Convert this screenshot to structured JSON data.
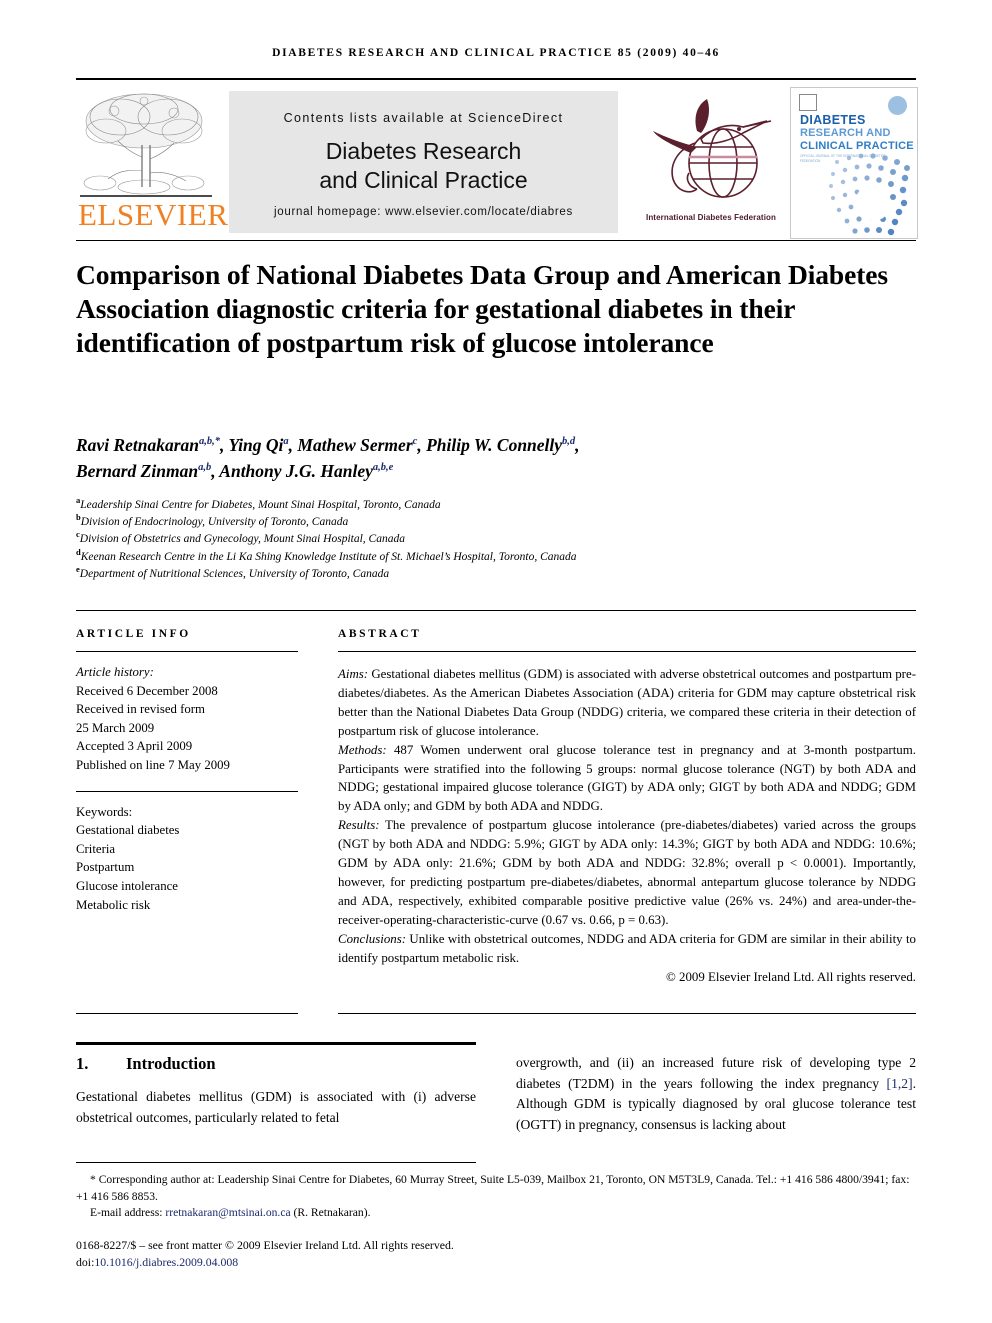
{
  "running_head": "Diabetes Research and Clinical Practice 85 (2009) 40–46",
  "masthead": {
    "publisher_name": "ELSEVIER",
    "publisher_color": "#F08122",
    "contents_line": "Contents lists available at ScienceDirect",
    "journal_title_line1": "Diabetes Research",
    "journal_title_line2": "and Clinical Practice",
    "homepage_line": "journal homepage: www.elsevier.com/locate/diabres",
    "idf_caption": "International Diabetes Federation",
    "cover": {
      "line1": "DIABETES",
      "line2": "RESEARCH AND",
      "line3": "CLINICAL PRACTICE",
      "subline": "OFFICIAL JOURNAL OF THE INTERNATIONAL DIABETES FEDERATION",
      "accent_color": "#2f7ec4"
    }
  },
  "article": {
    "title": "Comparison of National Diabetes Data Group and American Diabetes Association diagnostic criteria for gestational diabetes in their identification of postpartum risk of glucose intolerance",
    "authors_line1_a": "Ravi Retnakaran",
    "authors_line1_a_sup": "a,b,*",
    "authors_line1_b": ", Ying Qi",
    "authors_line1_b_sup": "a",
    "authors_line1_c": ", Mathew Sermer",
    "authors_line1_c_sup": "c",
    "authors_line1_d": ", Philip W. Connelly",
    "authors_line1_d_sup": "b,d",
    "authors_line1_end": ",",
    "authors_line2_a": "Bernard Zinman",
    "authors_line2_a_sup": "a,b",
    "authors_line2_b": ", Anthony J.G. Hanley",
    "authors_line2_b_sup": "a,b,e",
    "affiliations": [
      {
        "marker": "a",
        "text": "Leadership Sinai Centre for Diabetes, Mount Sinai Hospital, Toronto, Canada"
      },
      {
        "marker": "b",
        "text": "Division of Endocrinology, University of Toronto, Canada"
      },
      {
        "marker": "c",
        "text": "Division of Obstetrics and Gynecology, Mount Sinai Hospital, Canada"
      },
      {
        "marker": "d",
        "text": "Keenan Research Centre in the Li Ka Shing Knowledge Institute of St. Michael’s Hospital, Toronto, Canada"
      },
      {
        "marker": "e",
        "text": "Department of Nutritional Sciences, University of Toronto, Canada"
      }
    ]
  },
  "article_info": {
    "heading": "ARTICLE INFO",
    "history_label": "Article history:",
    "history": [
      "Received 6 December 2008",
      "Received in revised form",
      "25 March 2009",
      "Accepted 3 April 2009",
      "Published on line 7 May 2009"
    ],
    "keywords_label": "Keywords:",
    "keywords": [
      "Gestational diabetes",
      "Criteria",
      "Postpartum",
      "Glucose intolerance",
      "Metabolic risk"
    ]
  },
  "abstract": {
    "heading": "ABSTRACT",
    "aims_label": "Aims:",
    "aims_text": " Gestational diabetes mellitus (GDM) is associated with adverse obstetrical outcomes and postpartum pre-diabetes/diabetes. As the American Diabetes Association (ADA) criteria for GDM may capture obstetrical risk better than the National Diabetes Data Group (NDDG) criteria, we compared these criteria in their detection of postpartum risk of glucose intolerance.",
    "methods_label": "Methods:",
    "methods_text": " 487 Women underwent oral glucose tolerance test in pregnancy and at 3-month postpartum. Participants were stratified into the following 5 groups: normal glucose tolerance (NGT) by both ADA and NDDG; gestational impaired glucose tolerance (GIGT) by ADA only; GIGT by both ADA and NDDG; GDM by ADA only; and GDM by both ADA and NDDG.",
    "results_label": "Results:",
    "results_text": " The prevalence of postpartum glucose intolerance (pre-diabetes/diabetes) varied across the groups (NGT by both ADA and NDDG: 5.9%; GIGT by ADA only: 14.3%; GIGT by both ADA and NDDG: 10.6%; GDM by ADA only: 21.6%; GDM by both ADA and NDDG: 32.8%; overall p < 0.0001). Importantly, however, for predicting postpartum pre-diabetes/diabetes, abnormal antepartum glucose tolerance by NDDG and ADA, respectively, exhibited comparable positive predictive value (26% vs. 24%) and area-under-the-receiver-operating-characteristic-curve (0.67 vs. 0.66, p = 0.63).",
    "conclusions_label": "Conclusions:",
    "conclusions_text": " Unlike with obstetrical outcomes, NDDG and ADA criteria for GDM are similar in their ability to identify postpartum metabolic risk.",
    "copyright": "© 2009 Elsevier Ireland Ltd. All rights reserved."
  },
  "body": {
    "section_number": "1.",
    "section_title": "Introduction",
    "left_paragraph": "Gestational diabetes mellitus (GDM) is associated with (i) adverse obstetrical outcomes, particularly related to fetal",
    "right_paragraph_a": "overgrowth, and (ii) an increased future risk of developing type 2 diabetes (T2DM) in the years following the index pregnancy ",
    "right_citation": "[1,2]",
    "right_paragraph_b": ". Although GDM is typically diagnosed by oral glucose tolerance test (OGTT) in pregnancy, consensus is lacking about"
  },
  "footnote": {
    "corresponding": "* Corresponding author at: Leadership Sinai Centre for Diabetes, 60 Murray Street, Suite L5-039, Mailbox 21, Toronto, ON M5T3L9, Canada. Tel.: +1 416 586 4800/3941; fax: +1 416 586 8853.",
    "email_label": "E-mail address: ",
    "email_address": "rretnakaran@mtsinai.on.ca",
    "email_suffix": " (R. Retnakaran).",
    "issn_line": "0168-8227/$ – see front matter © 2009 Elsevier Ireland Ltd. All rights reserved.",
    "doi_prefix": "doi:",
    "doi_value": "10.1016/j.diabres.2009.04.008"
  }
}
